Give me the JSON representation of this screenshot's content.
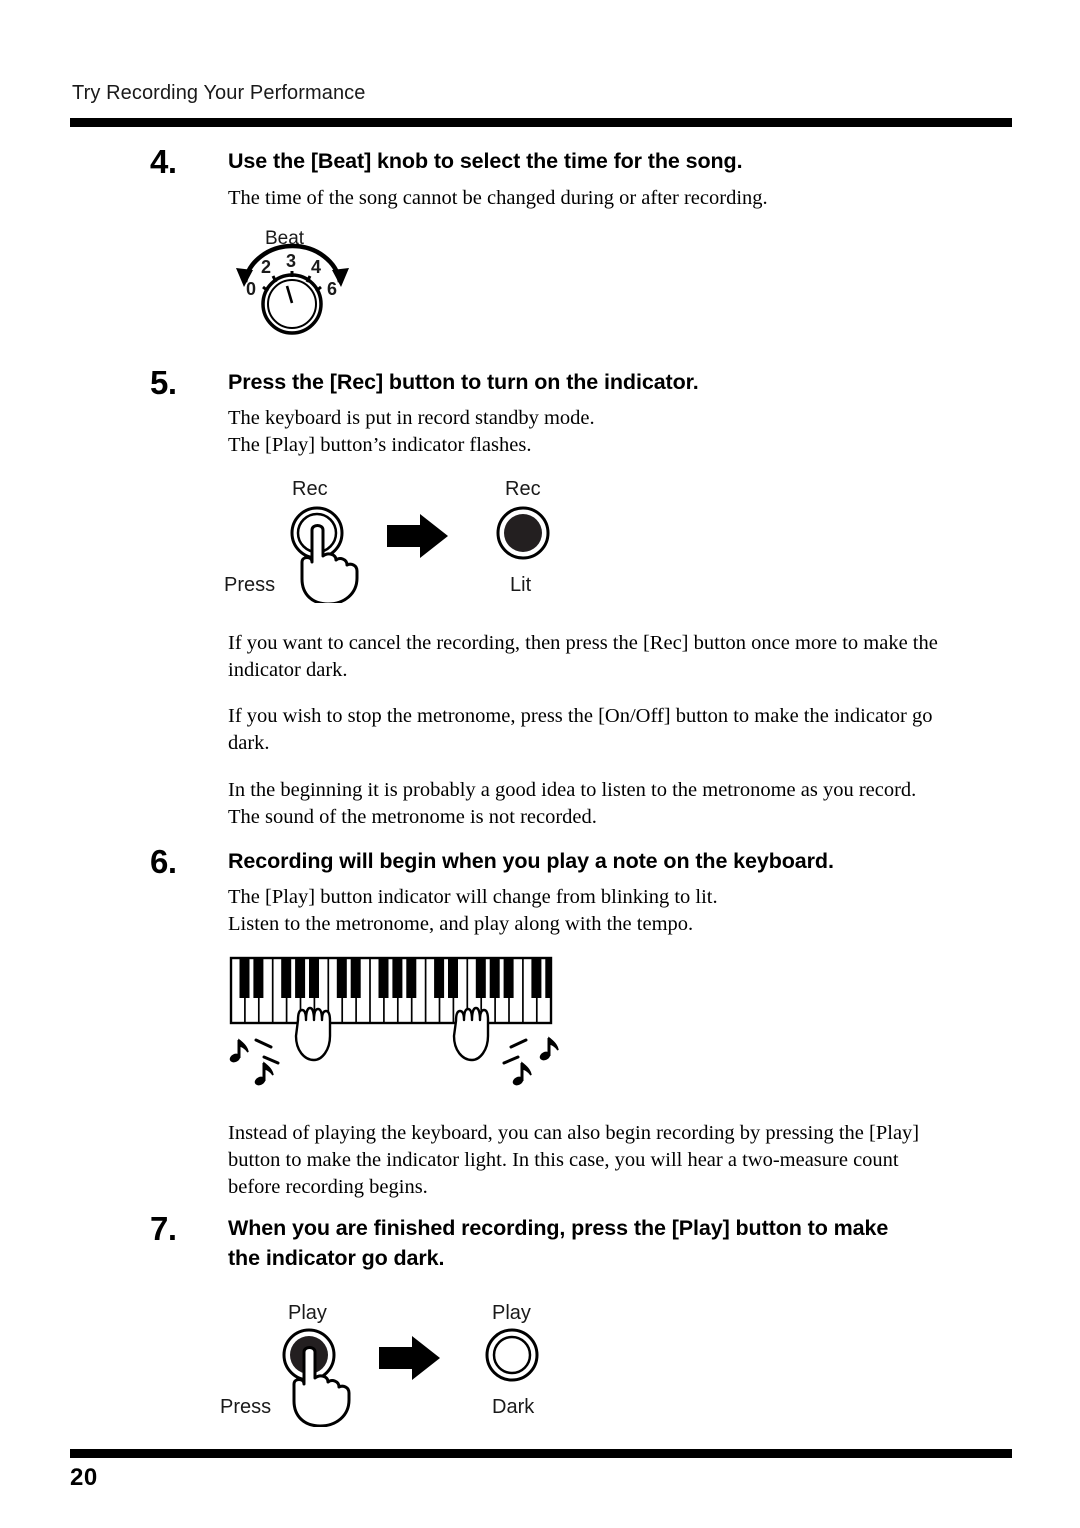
{
  "header": {
    "title": "Try Recording Your Performance"
  },
  "footer": {
    "page_number": "20"
  },
  "steps": [
    {
      "number": "4.",
      "heading": "Use the [Beat] knob to select the time for the song.",
      "body": "The time of the song cannot be changed during or after recording."
    },
    {
      "number": "5.",
      "heading": "Press the [Rec] button to turn on the indicator.",
      "body_line1": "The keyboard is put in record standby mode.",
      "body_line2": "The [Play] button’s indicator flashes."
    },
    {
      "number": "6.",
      "heading": "Recording will begin when you play a note on the keyboard.",
      "body_line1": "The [Play] button indicator will change from blinking to lit.",
      "body_line2": "Listen to the metronome, and play along with the tempo."
    },
    {
      "number": "7.",
      "heading": "When you are finished recording, press the [Play] button to make the indicator go dark."
    }
  ],
  "notes": [
    "If you want to cancel the recording, then press the [Rec] button once more to make the indicator dark.",
    "If you wish to stop the metronome, press the [On/Off] button to make the indicator go dark.",
    "In the beginning it is probably a good idea to listen to the metronome as you record. The sound of the metronome is not recorded.",
    "Instead of playing the keyboard, you can also begin recording by pressing the [Play] button to make the indicator light. In this case, you will hear a two-measure count before recording begins."
  ],
  "figures": {
    "beat_knob": {
      "label": "Beat",
      "ticks": [
        "0",
        "2",
        "3",
        "4",
        "6"
      ]
    },
    "rec_buttons": {
      "left_label": "Rec",
      "left_caption": "Press",
      "right_label": "Rec",
      "right_caption": "Lit"
    },
    "play_buttons": {
      "left_label": "Play",
      "left_caption": "Press",
      "right_label": "Play",
      "right_caption": "Dark"
    }
  },
  "colors": {
    "ink": "#000000",
    "paper": "#ffffff"
  }
}
